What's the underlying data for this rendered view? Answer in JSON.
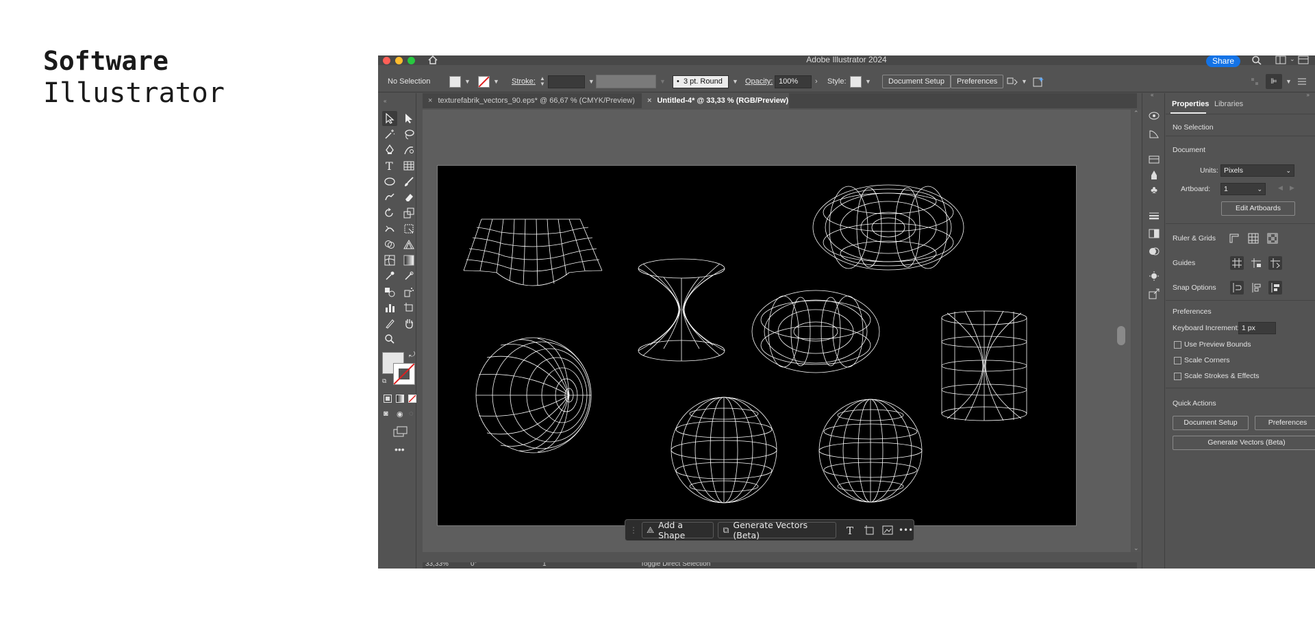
{
  "slide": {
    "title_line1": "Software",
    "title_line2": "Illustrator"
  },
  "window": {
    "title": "Adobe Illustrator 2024",
    "share_label": "Share"
  },
  "control_bar": {
    "selection": "No Selection",
    "stroke_label": "Stroke:",
    "brush_value": "3 pt. Round",
    "opacity_label": "Opacity:",
    "opacity_value": "100%",
    "style_label": "Style:",
    "document_setup": "Document Setup",
    "preferences": "Preferences"
  },
  "tabs": [
    {
      "label": "texturefabrik_vectors_90.eps* @ 66,67 % (CMYK/Preview)"
    },
    {
      "label": "Untitled-4* @ 33,33 % (RGB/Preview)"
    }
  ],
  "taskbar": {
    "add_shape": "Add a Shape",
    "generate_vectors": "Generate Vectors (Beta)"
  },
  "status": {
    "zoom": "33,33%",
    "rotation": "0°",
    "artboard": "1",
    "tool_hint": "Toggle Direct Selection"
  },
  "properties": {
    "tab_properties": "Properties",
    "tab_libraries": "Libraries",
    "no_selection": "No Selection",
    "document": "Document",
    "units_label": "Units:",
    "units_value": "Pixels",
    "artboard_label": "Artboard:",
    "artboard_value": "1",
    "edit_artboards": "Edit Artboards",
    "ruler_grids": "Ruler & Grids",
    "guides": "Guides",
    "snap_options": "Snap Options",
    "preferences_section": "Preferences",
    "keyboard_increment_label": "Keyboard Increment:",
    "keyboard_increment_value": "1 px",
    "use_preview_bounds": "Use Preview Bounds",
    "scale_corners": "Scale Corners",
    "scale_strokes": "Scale Strokes & Effects",
    "quick_actions": "Quick Actions",
    "document_setup": "Document Setup",
    "preferences": "Preferences",
    "generate_vectors": "Generate Vectors (Beta)"
  },
  "colors": {
    "accent": "#1473e6",
    "panel": "#535353",
    "canvas": "#5e5e5e",
    "artboard": "#000000"
  }
}
